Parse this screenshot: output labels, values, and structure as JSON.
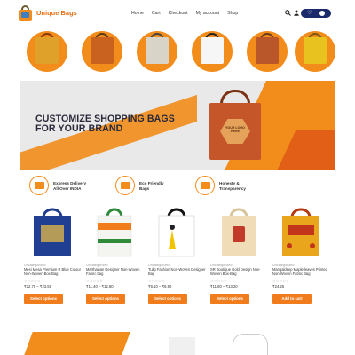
{
  "header": {
    "brand": "Unique Bags",
    "nav": [
      "Home",
      "Cart",
      "Checkout",
      "My account",
      "Shop"
    ],
    "icons": [
      "search-icon",
      "user-icon",
      "heart-icon",
      "cart-icon"
    ],
    "accent": "#f28c1b",
    "brand_color": "#e66e12",
    "pill_color": "#1b2a6b"
  },
  "banner": {
    "title_line1": "CUSTOMIZE SHOPPING BAGS",
    "title_line2": "FOR YOUR BRAND",
    "bag_text": "YOUR LOGO HERE"
  },
  "features": [
    {
      "line1": "Express Delivery",
      "line2": "All Over INDIA",
      "icon": "truck-icon"
    },
    {
      "line1": "Eco Friendly",
      "line2": "Bags",
      "icon": "eco-icon"
    },
    {
      "line1": "Honesty &",
      "line2": "Transparency",
      "icon": "handshake-icon"
    }
  ],
  "products": [
    {
      "category": "Uncategorized",
      "name": "Mesi Mesa Premium R Blue Colour Non-Woven Box-Bag",
      "rating": "☆☆☆☆☆",
      "price": "₹22.75 – ₹23.59",
      "button": "Select options"
    },
    {
      "category": "Uncategorized",
      "name": "Marthawan Designer Non-Woven Fabric bag",
      "rating": "☆☆☆☆☆",
      "price": "₹11.40 – ₹12.80",
      "button": "Select options"
    },
    {
      "category": "Uncategorized",
      "name": "Tulip Fashion Non-Woven Designer Bag",
      "rating": "☆☆☆☆☆",
      "price": "₹6.10 – ₹6.90",
      "button": "Select options"
    },
    {
      "category": "Uncategorized",
      "name": "SR Boutique Gold Design Non-Woven Box-Bag",
      "rating": "☆☆☆☆☆",
      "price": "₹11.80 – ₹13.20",
      "button": "Select options"
    },
    {
      "category": "Uncategorized",
      "name": "Mangaldeep Maple leaves Printed Non-Woven Fabric Bag",
      "rating": "☆☆☆☆☆",
      "price": "₹24.25",
      "button": "Add to cart"
    }
  ]
}
